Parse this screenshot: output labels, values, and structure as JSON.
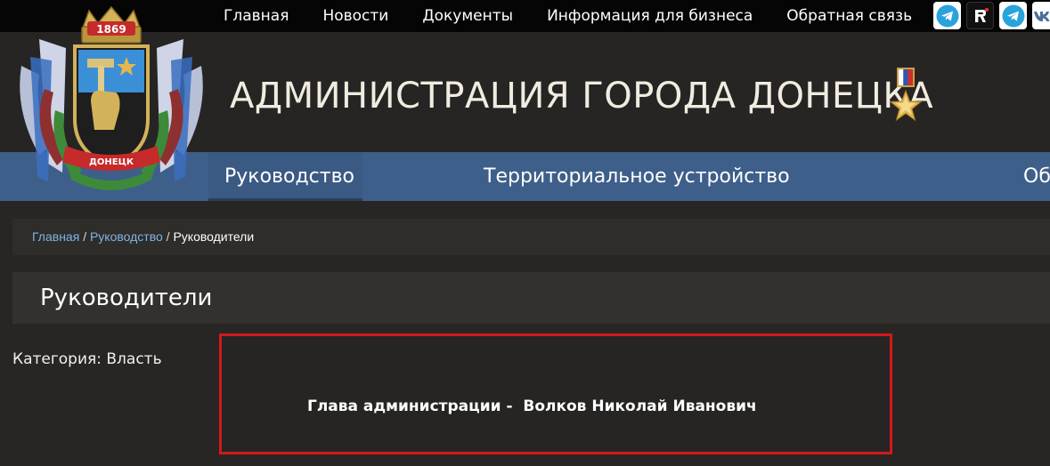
{
  "top_nav": {
    "items": [
      "Главная",
      "Новости",
      "Документы",
      "Информация для бизнеса",
      "Обратная связь"
    ]
  },
  "socials": {
    "icons": [
      "telegram-icon",
      "rutube-icon",
      "telegram-icon",
      "vk-icon"
    ],
    "colors": {
      "telegram": "#2aa3dc",
      "rutube_accent": "#ff2a2a"
    }
  },
  "header": {
    "title": "АДМИНИСТРАЦИЯ ГОРОДА ДОНЕЦКА",
    "crest_year": "1869",
    "crest_label": "ДОНЕЦК"
  },
  "main_nav": {
    "items": [
      "Руководство",
      "Территориальное устройство",
      "Об"
    ],
    "active": "Руководство"
  },
  "breadcrumb": {
    "home": "Главная",
    "section": "Руководство",
    "current": "Руководители",
    "separator": "/"
  },
  "page": {
    "title": "Руководители",
    "category": "Категория: Власть"
  },
  "card": {
    "text": "Глава администрации -  Волков Николай Иванович"
  },
  "colors": {
    "nav_bar": "#3e5f8a",
    "link": "#7fb3e8",
    "highlight_border": "#d11a1a",
    "background": "#272624"
  }
}
